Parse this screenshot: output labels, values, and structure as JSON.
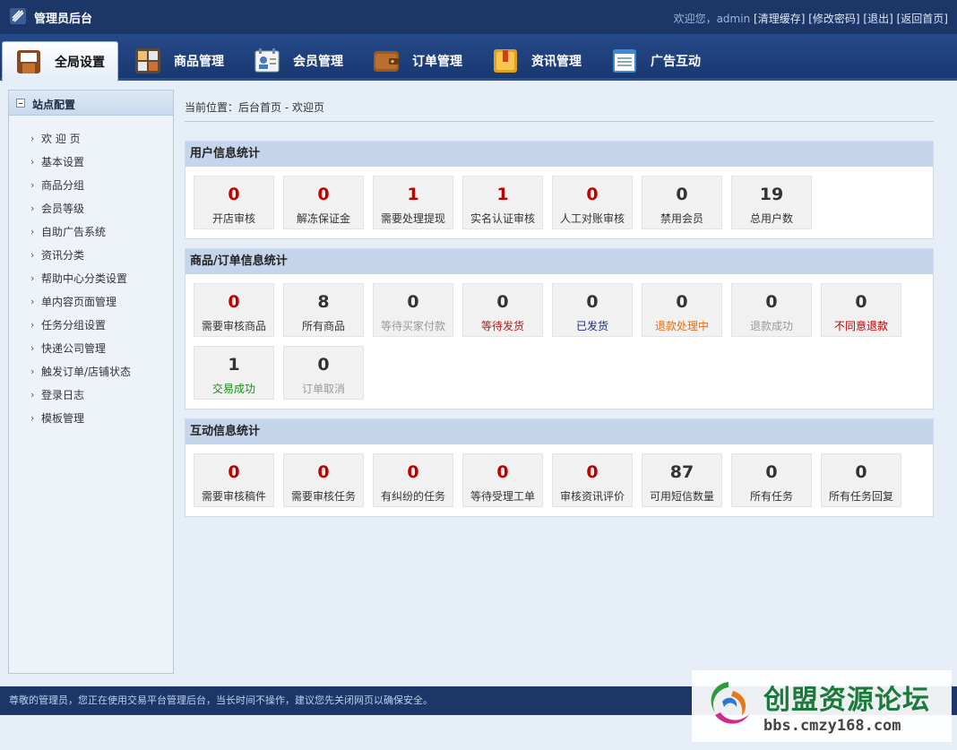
{
  "topbar": {
    "title": "管理员后台",
    "welcome": "欢迎您，admin",
    "links": [
      "[清理缓存]",
      "[修改密码]",
      "[退出]",
      "[返回首页]"
    ]
  },
  "nav": {
    "tabs": [
      {
        "label": "全局设置",
        "icon": "door-icon",
        "active": true
      },
      {
        "label": "商品管理",
        "icon": "grid-icon",
        "active": false
      },
      {
        "label": "会员管理",
        "icon": "member-card-icon",
        "active": false
      },
      {
        "label": "订单管理",
        "icon": "wallet-icon",
        "active": false
      },
      {
        "label": "资讯管理",
        "icon": "folder-icon",
        "active": false
      },
      {
        "label": "广告互动",
        "icon": "document-icon",
        "active": false
      }
    ]
  },
  "sidebar": {
    "title": "站点配置",
    "items": [
      "欢 迎 页",
      "基本设置",
      "商品分组",
      "会员等级",
      "自助广告系统",
      "资讯分类",
      "帮助中心分类设置",
      "单内容页面管理",
      "任务分组设置",
      "快递公司管理",
      "触发订单/店铺状态",
      "登录日志",
      "模板管理"
    ]
  },
  "breadcrumb": "当前位置：后台首页 - 欢迎页",
  "sections": [
    {
      "title": "用户信息统计",
      "cards": [
        {
          "value": "0",
          "label": "开店审核",
          "value_color": "#c00000",
          "label_color": "#333333"
        },
        {
          "value": "0",
          "label": "解冻保证金",
          "value_color": "#c00000",
          "label_color": "#333333"
        },
        {
          "value": "1",
          "label": "需要处理提现",
          "value_color": "#c00000",
          "label_color": "#333333"
        },
        {
          "value": "1",
          "label": "实名认证审核",
          "value_color": "#c00000",
          "label_color": "#333333"
        },
        {
          "value": "0",
          "label": "人工对账审核",
          "value_color": "#c00000",
          "label_color": "#333333"
        },
        {
          "value": "0",
          "label": "禁用会员",
          "value_color": "#333333",
          "label_color": "#333333"
        },
        {
          "value": "19",
          "label": "总用户数",
          "value_color": "#333333",
          "label_color": "#333333"
        }
      ]
    },
    {
      "title": "商品/订单信息统计",
      "cards": [
        {
          "value": "0",
          "label": "需要审核商品",
          "value_color": "#c00000",
          "label_color": "#333333"
        },
        {
          "value": "8",
          "label": "所有商品",
          "value_color": "#333333",
          "label_color": "#333333"
        },
        {
          "value": "0",
          "label": "等待买家付款",
          "value_color": "#333333",
          "label_color": "#999999"
        },
        {
          "value": "0",
          "label": "等待发货",
          "value_color": "#333333",
          "label_color": "#b01818"
        },
        {
          "value": "0",
          "label": "已发货",
          "value_color": "#333333",
          "label_color": "#1a2a8a"
        },
        {
          "value": "0",
          "label": "退款处理中",
          "value_color": "#333333",
          "label_color": "#e07020"
        },
        {
          "value": "0",
          "label": "退款成功",
          "value_color": "#333333",
          "label_color": "#999999"
        },
        {
          "value": "0",
          "label": "不同意退款",
          "value_color": "#333333",
          "label_color": "#c00000"
        },
        {
          "value": "1",
          "label": "交易成功",
          "value_color": "#333333",
          "label_color": "#1a8a1a"
        },
        {
          "value": "0",
          "label": "订单取消",
          "value_color": "#333333",
          "label_color": "#999999"
        }
      ]
    },
    {
      "title": "互动信息统计",
      "cards": [
        {
          "value": "0",
          "label": "需要审核稿件",
          "value_color": "#c00000",
          "label_color": "#333333"
        },
        {
          "value": "0",
          "label": "需要审核任务",
          "value_color": "#c00000",
          "label_color": "#333333"
        },
        {
          "value": "0",
          "label": "有纠纷的任务",
          "value_color": "#c00000",
          "label_color": "#333333"
        },
        {
          "value": "0",
          "label": "等待受理工单",
          "value_color": "#c00000",
          "label_color": "#333333"
        },
        {
          "value": "0",
          "label": "审核资讯评价",
          "value_color": "#c00000",
          "label_color": "#333333"
        },
        {
          "value": "87",
          "label": "可用短信数量",
          "value_color": "#333333",
          "label_color": "#333333"
        },
        {
          "value": "0",
          "label": "所有任务",
          "value_color": "#333333",
          "label_color": "#333333"
        },
        {
          "value": "0",
          "label": "所有任务回复",
          "value_color": "#333333",
          "label_color": "#333333"
        }
      ]
    }
  ],
  "footer": "尊敬的管理员，您正在使用交易平台管理后台，当长时间不操作，建议您先关闭网页以确保安全。",
  "watermark": {
    "title": "创盟资源论坛",
    "url": "bbs.cmzy168.com"
  }
}
